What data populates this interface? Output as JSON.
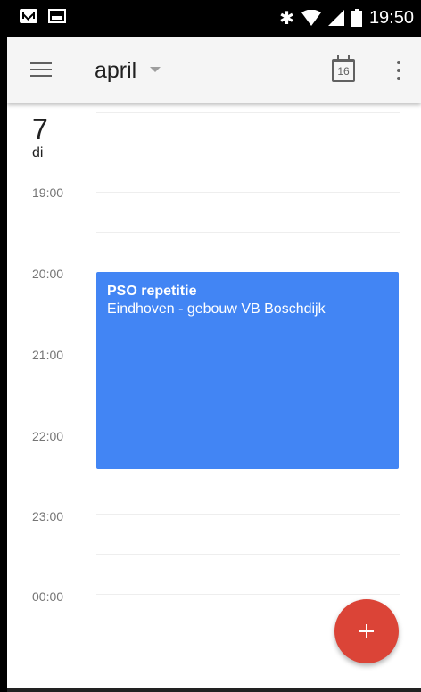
{
  "status_bar": {
    "time": "19:50",
    "icons": [
      "gmail-icon",
      "photo-icon",
      "bluetooth-icon",
      "wifi-icon",
      "signal-icon",
      "battery-icon"
    ]
  },
  "app_bar": {
    "month": "april",
    "today_day": "16",
    "icons": [
      "menu-icon",
      "today-calendar-icon",
      "overflow-menu-icon"
    ]
  },
  "day": {
    "number": "7",
    "name": "di"
  },
  "hours": [
    "19:00",
    "20:00",
    "21:00",
    "22:00",
    "23:00",
    "00:00"
  ],
  "event": {
    "title": "PSO repetitie",
    "location": "Eindhoven - gebouw VB Boschdijk",
    "color": "#4285f4"
  },
  "fab": {
    "icon": "add-icon",
    "color": "#db4437"
  }
}
